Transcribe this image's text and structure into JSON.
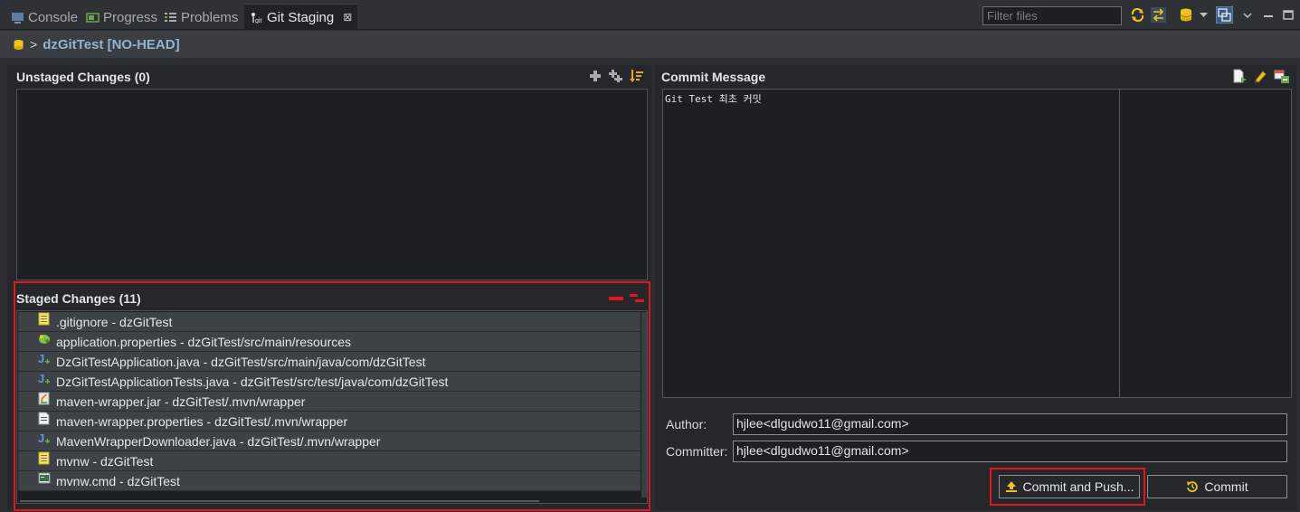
{
  "tabs": [
    {
      "label": "Console",
      "icon": "console-icon"
    },
    {
      "label": "Progress",
      "icon": "progress-icon"
    },
    {
      "label": "Problems",
      "icon": "problems-icon"
    },
    {
      "label": "Git Staging",
      "icon": "git-icon",
      "active": true,
      "close": "⊠"
    }
  ],
  "toolbar": {
    "filter_placeholder": "Filter files"
  },
  "breadcrumb": {
    "separator": ">",
    "repository": "dzGitTest [NO-HEAD]"
  },
  "unstaged": {
    "title": "Unstaged Changes (0)"
  },
  "staged": {
    "title": "Staged Changes (11)",
    "files": [
      {
        "label": ".gitignore - dzGitTest",
        "icon": "text-file-icon"
      },
      {
        "label": "application.properties - dzGitTest/src/main/resources",
        "icon": "properties-file-icon"
      },
      {
        "label": "DzGitTestApplication.java - dzGitTest/src/main/java/com/dzGitTest",
        "icon": "java-file-icon"
      },
      {
        "label": "DzGitTestApplicationTests.java - dzGitTest/src/test/java/com/dzGitTest",
        "icon": "java-file-icon"
      },
      {
        "label": "maven-wrapper.jar - dzGitTest/.mvn/wrapper",
        "icon": "jar-file-icon"
      },
      {
        "label": "maven-wrapper.properties - dzGitTest/.mvn/wrapper",
        "icon": "plain-file-icon"
      },
      {
        "label": "MavenWrapperDownloader.java - dzGitTest/.mvn/wrapper",
        "icon": "java-file-icon"
      },
      {
        "label": "mvnw - dzGitTest",
        "icon": "text-file-icon"
      },
      {
        "label": "mvnw.cmd - dzGitTest",
        "icon": "cmd-file-icon"
      }
    ]
  },
  "commit": {
    "title": "Commit Message",
    "message": "Git Test 최초 커밋",
    "author_label": "Author:",
    "author_value": "hjlee<dlgudwo11@gmail.com>",
    "committer_label": "Committer:",
    "committer_value": "hjlee<dlgudwo11@gmail.com>",
    "commit_push_label": "Commit and Push...",
    "commit_label": "Commit"
  },
  "colors": {
    "accent_red": "#e4161b",
    "breadcrumb_blue": "#8fb4d6",
    "icon_yellow": "#f0c419"
  }
}
